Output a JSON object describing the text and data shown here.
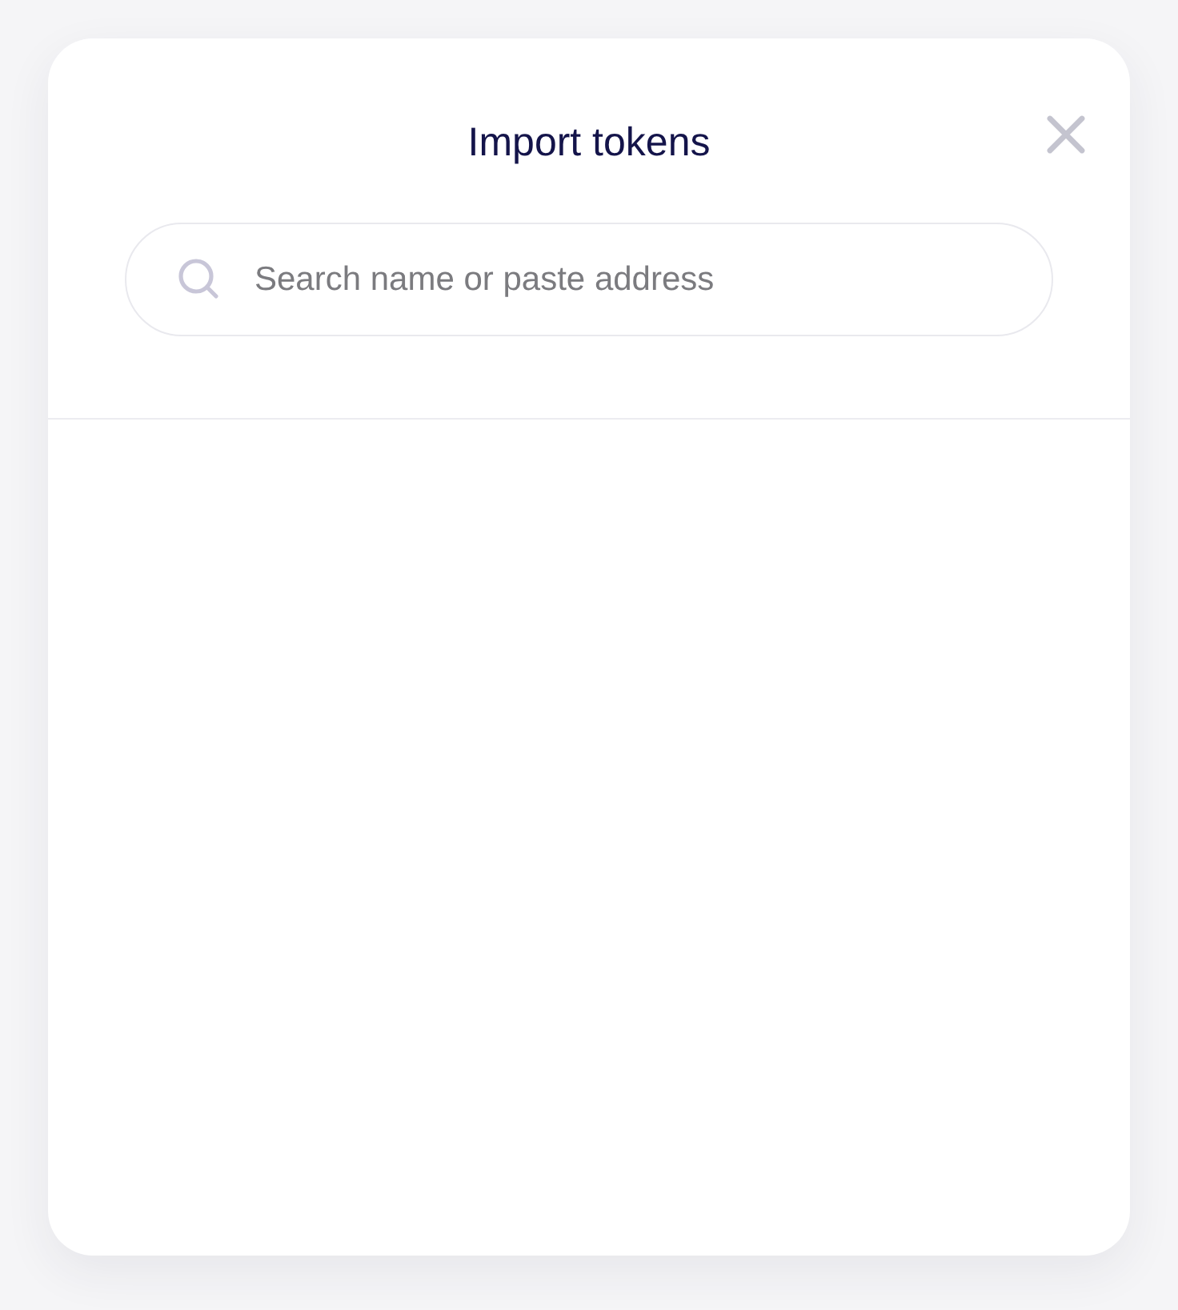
{
  "dialog": {
    "title": "Import tokens"
  },
  "search": {
    "placeholder": "Search name or paste address"
  }
}
